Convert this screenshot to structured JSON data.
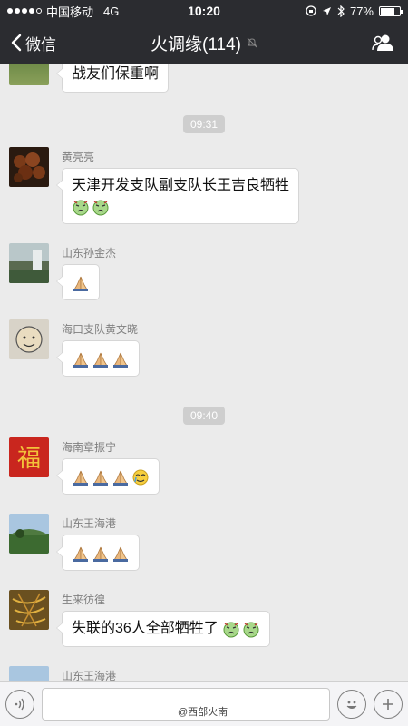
{
  "status_bar": {
    "carrier": "中国移动",
    "network": "4G",
    "time": "10:20",
    "battery": "77%",
    "battery_level": 0.77
  },
  "nav": {
    "back_label": "微信",
    "title": "火调缘(114)"
  },
  "chat": {
    "top_partial_text": "战友们保重啊",
    "timestamps": [
      "09:31",
      "09:40"
    ],
    "messages": [
      {
        "sender": "黄亮亮",
        "text": "天津开发支队副支队长王吉良牺牲",
        "emojis": [
          "angry-face-icon",
          "angry-face-icon"
        ]
      },
      {
        "sender": "山东孙金杰",
        "text": "",
        "emojis": [
          "pray-icon"
        ]
      },
      {
        "sender": "海口支队黄文晓",
        "text": "",
        "emojis": [
          "pray-icon",
          "pray-icon",
          "pray-icon"
        ]
      },
      {
        "sender": "海南章振宁",
        "text": "",
        "emojis": [
          "pray-icon",
          "pray-icon",
          "pray-icon",
          "crying-face-icon"
        ]
      },
      {
        "sender": "山东王海港",
        "text": "",
        "emojis": [
          "pray-icon",
          "pray-icon",
          "pray-icon"
        ]
      },
      {
        "sender": "生来彷徨",
        "text": "失联的36人全部牺牲了",
        "emojis": [
          "angry-face-icon",
          "angry-face-icon"
        ]
      },
      {
        "sender": "山东王海港",
        "text": "",
        "emojis": []
      }
    ]
  },
  "watermark": "@西部火南",
  "colors": {
    "header_bg": "#2b2c30",
    "chat_bg": "#ebebeb",
    "bubble_bg": "#ffffff",
    "time_label_bg": "#cecece"
  }
}
